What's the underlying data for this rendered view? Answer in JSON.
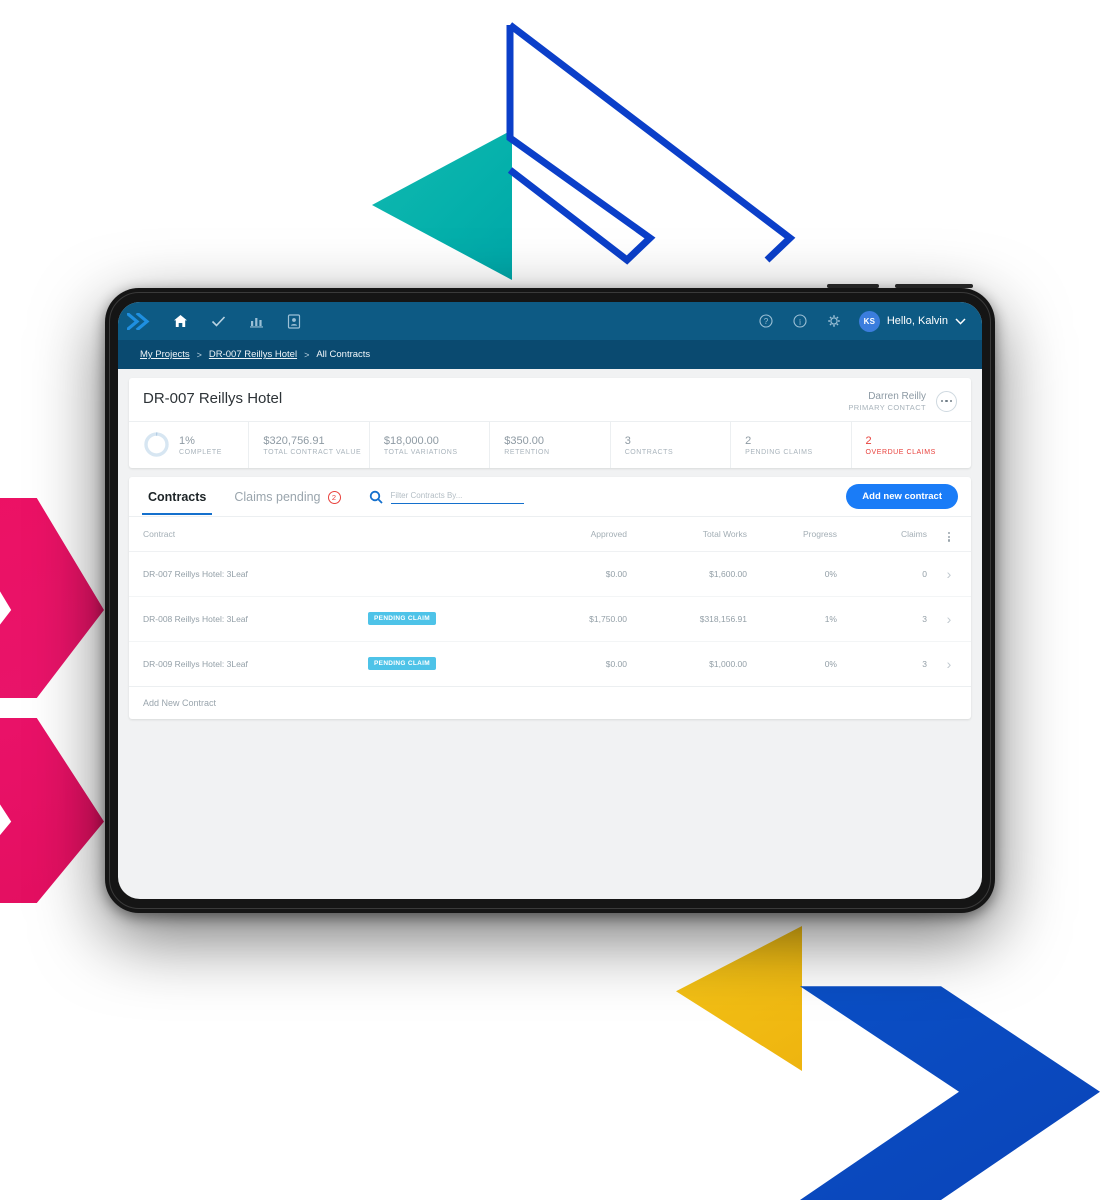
{
  "topbar": {
    "logo_name": "double-chevron-logo",
    "nav_icons": [
      {
        "name": "home-icon",
        "label": "Home"
      },
      {
        "name": "check-icon",
        "label": "Tasks"
      },
      {
        "name": "chart-icon",
        "label": "Reports"
      },
      {
        "name": "contact-card-icon",
        "label": "Contacts"
      }
    ],
    "right_icons": [
      {
        "name": "help-icon",
        "label": "Help"
      },
      {
        "name": "info-icon",
        "label": "Info"
      },
      {
        "name": "gear-icon",
        "label": "Settings"
      }
    ],
    "avatar_initials": "KS",
    "user_greeting": "Hello, Kalvin"
  },
  "breadcrumb": {
    "items": [
      {
        "label": "My Projects",
        "link": true
      },
      {
        "label": "DR-007 Reillys Hotel",
        "link": true
      },
      {
        "label": "All Contracts",
        "link": false
      }
    ],
    "separator": ">"
  },
  "project": {
    "title": "DR-007 Reillys Hotel",
    "contact_name": "Darren Reilly",
    "contact_role": "PRIMARY CONTACT",
    "stats": [
      {
        "value": "1%",
        "label": "COMPLETE",
        "alert": false,
        "donut": 1
      },
      {
        "value": "$320,756.91",
        "label": "TOTAL CONTRACT VALUE",
        "alert": false
      },
      {
        "value": "$18,000.00",
        "label": "TOTAL VARIATIONS",
        "alert": false
      },
      {
        "value": "$350.00",
        "label": "RETENTION",
        "alert": false
      },
      {
        "value": "3",
        "label": "CONTRACTS",
        "alert": false
      },
      {
        "value": "2",
        "label": "PENDING CLAIMS",
        "alert": false
      },
      {
        "value": "2",
        "label": "OVERDUE CLAIMS",
        "alert": true
      }
    ]
  },
  "tabs": [
    {
      "label": "Contracts",
      "active": true,
      "badge": null
    },
    {
      "label": "Claims pending",
      "active": false,
      "badge": "2"
    }
  ],
  "search": {
    "placeholder": "Filter Contracts By...",
    "value": ""
  },
  "add_button_label": "Add new contract",
  "table": {
    "columns": [
      "Contract",
      "Approved",
      "Total Works",
      "Progress",
      "Claims"
    ],
    "rows": [
      {
        "contract": "DR-007 Reillys Hotel: 3Leaf",
        "badge": "",
        "approved": "$0.00",
        "total_works": "$1,600.00",
        "progress": "0%",
        "claims": "0"
      },
      {
        "contract": "DR-008 Reillys Hotel: 3Leaf",
        "badge": "PENDING CLAIM",
        "approved": "$1,750.00",
        "total_works": "$318,156.91",
        "progress": "1%",
        "claims": "3"
      },
      {
        "contract": "DR-009 Reillys Hotel: 3Leaf",
        "badge": "PENDING CLAIM",
        "approved": "$0.00",
        "total_works": "$1,000.00",
        "progress": "0%",
        "claims": "3"
      }
    ],
    "footer_label": "Add New Contract"
  },
  "colors": {
    "topbar": "#0d5a84",
    "breadcrumb": "#0a4a70",
    "accent_blue": "#1a7cf7",
    "tab_underline": "#1470cd",
    "alert_red": "#e8413c",
    "badge_cyan": "#4ec3e8",
    "deco_teal": "#04b0ab",
    "deco_pink": "#ea1269",
    "deco_yellow": "#f0b912",
    "deco_blue": "#0a44b8"
  }
}
